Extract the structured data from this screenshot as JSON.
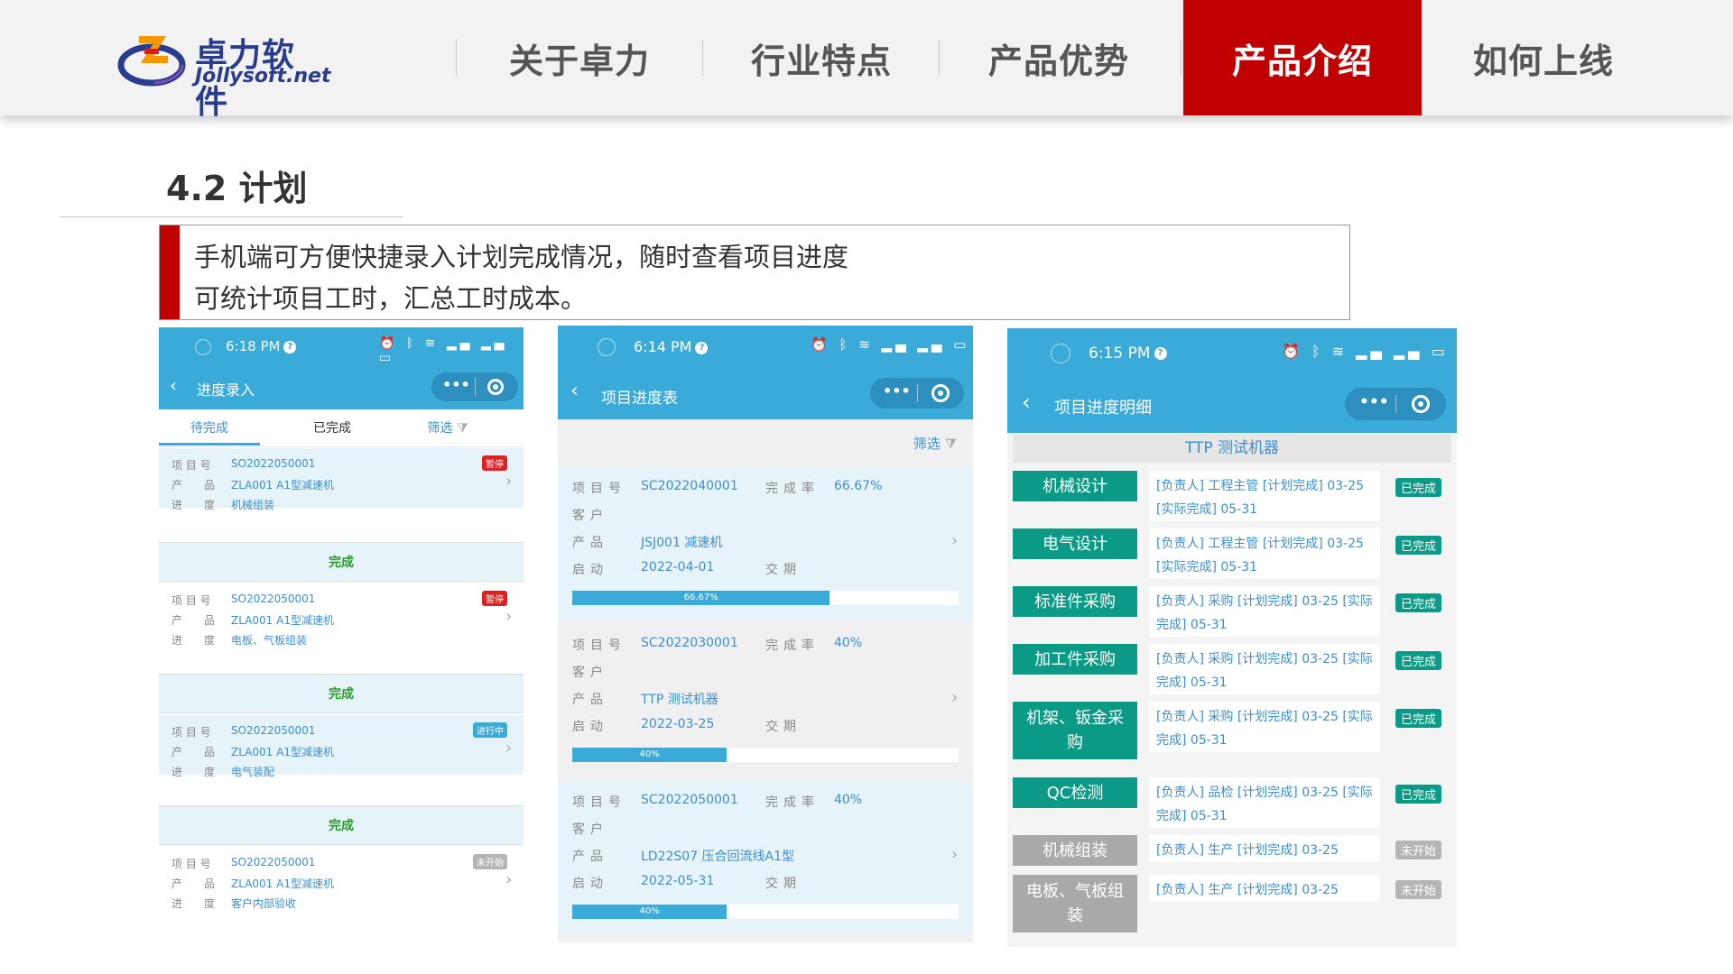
{
  "logo": {
    "cn": "卓力软件",
    "en": "Jollysoft.net"
  },
  "nav": {
    "items": [
      "关于卓力",
      "行业特点",
      "产品优势",
      "产品介绍",
      "如何上线"
    ],
    "active_index": 3
  },
  "section": {
    "title": "4.2 计划"
  },
  "description": {
    "line1": "手机端可方便快捷录入计划完成情况，随时查看项目进度",
    "line2": "可统计项目工时，汇总工时成本。"
  },
  "phone1": {
    "time": "6:18 PM",
    "title": "进度录入",
    "tabs": [
      "待完成",
      "已完成",
      "筛选"
    ],
    "labels": {
      "project_no": "项 目 号",
      "product": "产　　品",
      "progress": "进　　度"
    },
    "cards": [
      {
        "project_no": "SO2022050001",
        "product": "ZLA001 A1型减速机",
        "progress": "机械组装",
        "badge": "暂停",
        "badge_color": "#e02020"
      },
      {
        "project_no": "SO2022050001",
        "product": "ZLA001 A1型减速机",
        "progress": "电板、气板组装",
        "badge": "暂停",
        "badge_color": "#e02020"
      },
      {
        "project_no": "SO2022050001",
        "product": "ZLA001 A1型减速机",
        "progress": "电气装配",
        "badge": "进行中",
        "badge_color": "#3aaad9"
      },
      {
        "project_no": "SO2022050001",
        "product": "ZLA001 A1型减速机",
        "progress": "客户内部验收",
        "badge": "未开始",
        "badge_color": "#b5b5b5"
      }
    ],
    "done_label": "完成"
  },
  "phone2": {
    "time": "6:14 PM",
    "title": "项目进度表",
    "filter": "筛选",
    "labels": {
      "project_no": "项目号",
      "rate": "完成率",
      "customer": "客户",
      "product": "产品",
      "start": "启动",
      "delivery": "交期"
    },
    "cards": [
      {
        "project_no": "SC2022040001",
        "rate": "66.67%",
        "customer": "",
        "product": "JSJ001 减速机",
        "start": "2022-04-01",
        "delivery": "",
        "progress": 0.6667,
        "progress_label": "66.67%"
      },
      {
        "project_no": "SC2022030001",
        "rate": "40%",
        "customer": "",
        "product": "TTP 测试机器",
        "start": "2022-03-25",
        "delivery": "",
        "progress": 0.4,
        "progress_label": "40%"
      },
      {
        "project_no": "SC2022050001",
        "rate": "40%",
        "customer": "",
        "product": "LD22S07 压合回流线A1型",
        "start": "2022-05-31",
        "delivery": "",
        "progress": 0.4,
        "progress_label": "40%"
      }
    ]
  },
  "phone3": {
    "time": "6:15 PM",
    "title": "项目进度明细",
    "machine": "TTP 测试机器",
    "rows": [
      {
        "stage": "机械设计",
        "detail": "[负责人] 工程主管 [计划完成] 03-25 [实际完成] 05-31",
        "status": "已完成",
        "done": true
      },
      {
        "stage": "电气设计",
        "detail": "[负责人] 工程主管 [计划完成] 03-25 [实际完成] 05-31",
        "status": "已完成",
        "done": true
      },
      {
        "stage": "标准件采购",
        "detail": "[负责人] 采购 [计划完成] 03-25 [实际完成] 05-31",
        "status": "已完成",
        "done": true
      },
      {
        "stage": "加工件采购",
        "detail": "[负责人] 采购 [计划完成] 03-25 [实际完成] 05-31",
        "status": "已完成",
        "done": true
      },
      {
        "stage": "机架、钣金采购",
        "detail": "[负责人] 采购 [计划完成] 03-25 [实际完成] 05-31",
        "status": "已完成",
        "done": true
      },
      {
        "stage": "QC检测",
        "detail": "[负责人] 品检 [计划完成] 03-25 [实际完成] 05-31",
        "status": "已完成",
        "done": true
      },
      {
        "stage": "机械组装",
        "detail": "[负责人] 生产 [计划完成] 03-25",
        "status": "未开始",
        "done": false
      },
      {
        "stage": "电板、气板组装",
        "detail": "[负责人] 生产 [计划完成] 03-25",
        "status": "未开始",
        "done": false
      }
    ]
  },
  "colors": {
    "brand_red": "#c00000",
    "app_blue": "#3aaad9",
    "stage_green": "#0a9a86"
  }
}
